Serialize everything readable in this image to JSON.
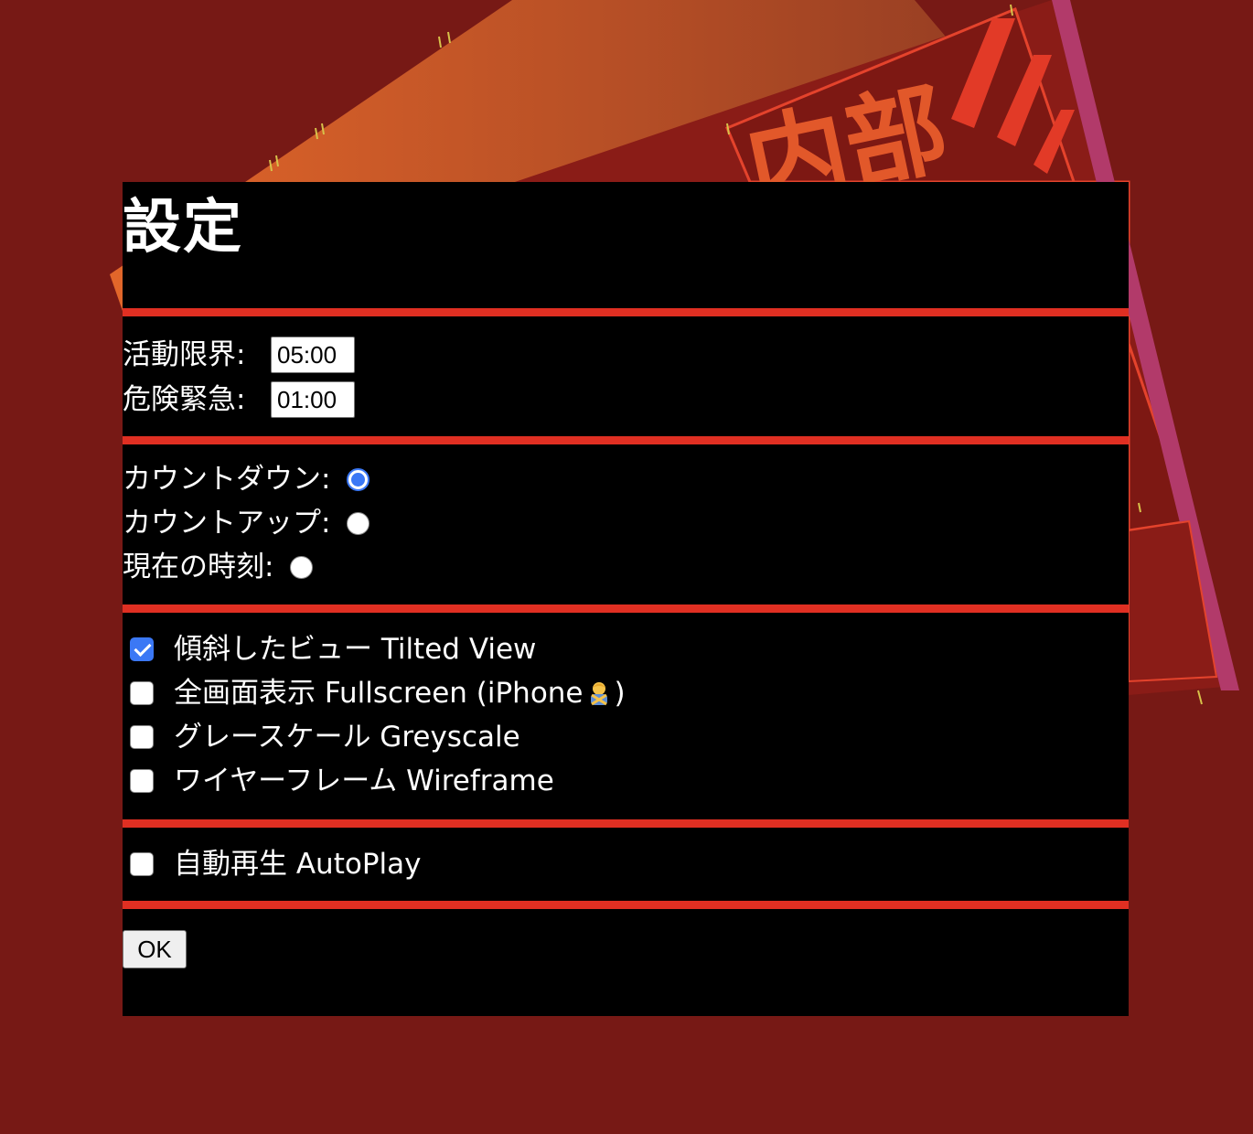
{
  "background": {
    "color": "#771915",
    "panel_text": "内部"
  },
  "dialog": {
    "title": "設定",
    "accent_color": "#e02f22",
    "time_fields": [
      {
        "label": "活動限界:",
        "value": "05:00"
      },
      {
        "label": "危険緊急:",
        "value": "01:00"
      }
    ],
    "mode_options": [
      {
        "label": "カウントダウン:",
        "checked": true
      },
      {
        "label": "カウントアップ:",
        "checked": false
      },
      {
        "label": "現在の時刻:",
        "checked": false
      }
    ],
    "view_options": [
      {
        "label": "傾斜したビュー Tilted View",
        "checked": true
      },
      {
        "label": "全画面表示 Fullscreen (iPhone",
        "suffix": ")",
        "icon": "person-gesturing-no-icon",
        "checked": false
      },
      {
        "label": "グレースケール Greyscale",
        "checked": false
      },
      {
        "label": "ワイヤーフレーム Wireframe",
        "checked": false
      }
    ],
    "autoplay": {
      "label": "自動再生 AutoPlay",
      "checked": false
    },
    "ok_label": "OK"
  }
}
